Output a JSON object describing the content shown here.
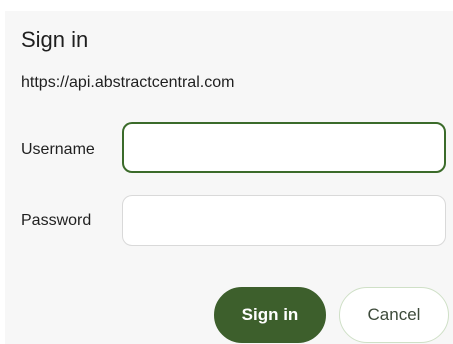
{
  "dialog": {
    "title": "Sign in",
    "origin": "https://api.abstractcentral.com"
  },
  "form": {
    "username_label": "Username",
    "username_value": "",
    "password_label": "Password",
    "password_value": ""
  },
  "buttons": {
    "sign_in_label": "Sign in",
    "cancel_label": "Cancel"
  },
  "colors": {
    "primary": "#3d5f2c",
    "focus_border": "#3b6b2a",
    "dialog_background": "#f7f7f7"
  }
}
